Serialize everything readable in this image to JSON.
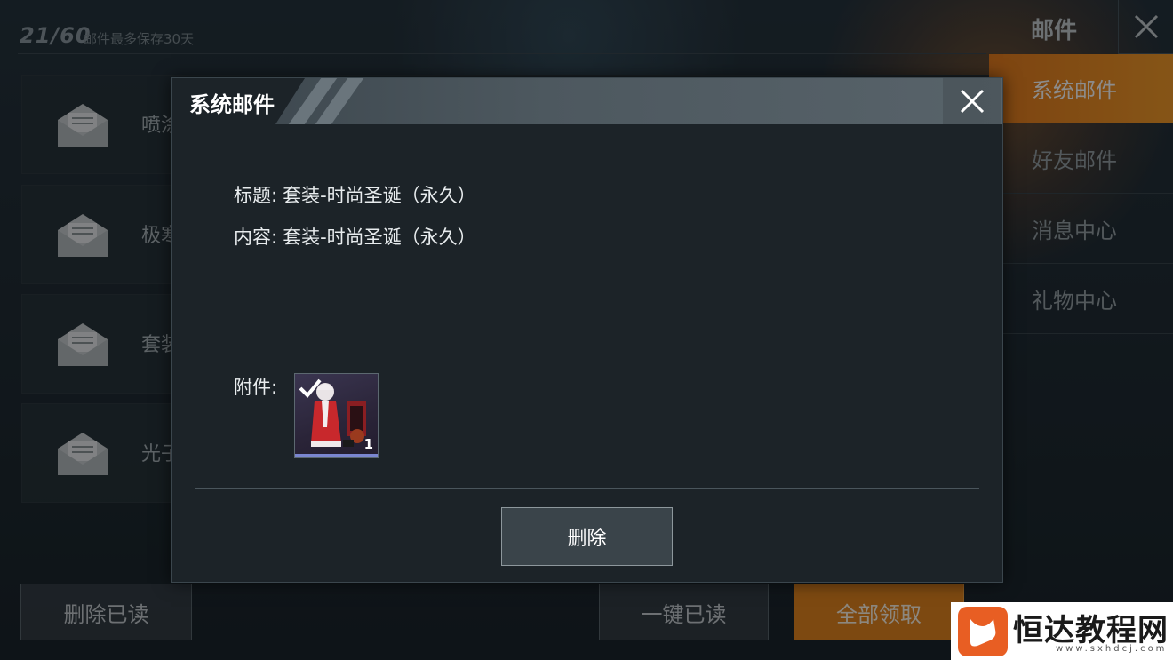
{
  "background": {
    "mail_count": "21/60",
    "mail_note": "邮件最多保存30天",
    "mail_previews": [
      "喷涂",
      "极寒",
      "套装",
      "光子"
    ],
    "side_title": "邮件",
    "side_tabs": [
      {
        "label": "系统邮件",
        "active": true
      },
      {
        "label": "好友邮件",
        "active": false
      },
      {
        "label": "消息中心",
        "active": false
      },
      {
        "label": "礼物中心",
        "active": false
      }
    ],
    "bottom_buttons": {
      "delete_read": "删除已读",
      "mark_all_read": "一键已读",
      "claim_all": "全部领取"
    }
  },
  "modal": {
    "title": "系统邮件",
    "subject_label": "标题:",
    "subject_value": "套装-时尚圣诞（永久）",
    "content_label": "内容:",
    "content_value": "套装-时尚圣诞（永久）",
    "attachment_label": "附件:",
    "attachment": {
      "quantity": "1",
      "claimed": true,
      "icon": "christmas-outfit-icon"
    },
    "delete_label": "删除"
  },
  "watermark": {
    "name": "恒达教程网",
    "url": "www.sxhdcj.com"
  },
  "colors": {
    "accent_orange": "#e67d1f",
    "modal_bg": "#1c2328",
    "attachment_bar": "#7a86d0"
  }
}
